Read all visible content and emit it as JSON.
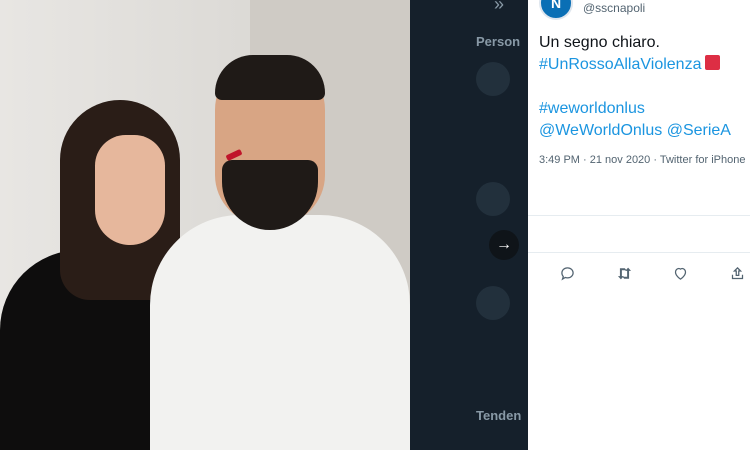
{
  "tweet": {
    "handle": "@sscnapoli",
    "avatar_letter": "N",
    "line1": "Un segno chiaro.",
    "line2_hashtag": "#UnRossoAllaViolenza",
    "line3_hashtag": "#weworldonlus",
    "line4_mention1": "@WeWorldOnlus",
    "line4_mention2": "@SerieA",
    "timestamp": "3:49 PM · 21 nov 2020 · Twitter for iPhone",
    "actions": [
      "reply-icon",
      "retweet-icon",
      "like-icon",
      "share-icon"
    ]
  },
  "background_panel": {
    "heading": "Person",
    "trending_heading": "Tenden"
  },
  "colors": {
    "link": "#1b95e0",
    "dark_bg": "#15202b",
    "red_square": "#dd2e44"
  }
}
